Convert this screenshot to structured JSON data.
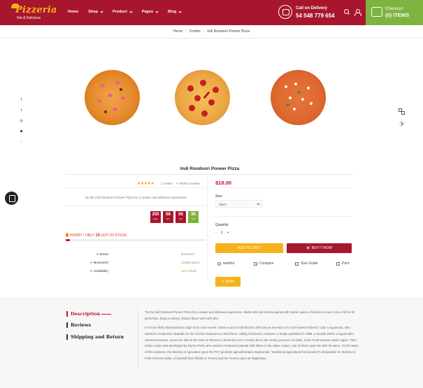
{
  "header": {
    "logo": {
      "title": "Pizzeria",
      "subtitle": "Hot & Delicious"
    },
    "nav": [
      {
        "label": "Home",
        "dropdown": false
      },
      {
        "label": "Shop",
        "dropdown": true
      },
      {
        "label": "Product",
        "dropdown": true
      },
      {
        "label": "Pages",
        "dropdown": true
      },
      {
        "label": "Blog",
        "dropdown": true
      }
    ],
    "delivery": {
      "label": "Call on Delivery",
      "phone": "54 548 779 654"
    },
    "checkout": {
      "label": "Checkout",
      "items": "(0) ITEMS"
    }
  },
  "breadcrumb": [
    "Home",
    "Combo",
    "Indi Rondoori Poneer Pizza"
  ],
  "social_icons": [
    "facebook-icon",
    "twitter-icon",
    "dribbble-icon",
    "instagram-icon",
    "whatsapp-icon"
  ],
  "product": {
    "title": "Indi Rondoori Poneer Pizza",
    "stars": "★★★★★",
    "review_count": "1 review",
    "write_review": "Write a review",
    "description": "Try the Indi Rondoori Poneer Pizza for a unique and delicious experience",
    "countdown": [
      {
        "value": "250",
        "unit": "Days"
      },
      {
        "value": "08",
        "unit": "Hrs"
      },
      {
        "value": "56",
        "unit": "Min"
      },
      {
        "value": "36",
        "unit": "Sec"
      }
    ],
    "stock": {
      "prefix": "HURRY ! ONLY",
      "count": "10",
      "suffix": "LEFT IN STOCK.",
      "level_percent": 3
    },
    "meta": [
      {
        "key": "Brand :",
        "value": "Domino's"
      },
      {
        "key": "Movement :",
        "value": "Combo pizza"
      },
      {
        "key": "Availability :",
        "value": "10 In Stock"
      }
    ],
    "price": "$18.00",
    "size_label": "Size",
    "size_selected": "25cm",
    "quantity_label": "Quantity",
    "quantity": {
      "minus": "-",
      "value": "1",
      "plus": "+"
    },
    "add_to_cart": "ADD TO CART",
    "buy_now": "BUY IT NOW",
    "actions": {
      "wishlist": "wishlist",
      "compare": "Compare",
      "size_guide": "Size Guide",
      "print": "Print"
    },
    "share": "Share"
  },
  "tabs": {
    "description": "Description",
    "reviews": "Reviews",
    "shipping": "Shipping and Return"
  },
  "description_text": {
    "p1": "Try the Indi Rondoori Poneer Pizza for a unique and delicious experience. Made with real cheese paired with classic spices, this pizza is sure to be a hit for all pizza fans. Enjoy a savory, cheesy flavor with each bite.",
    "p2": "It is more likely that tiramisu's origin is far more recent. Some sources hold that the dish was an invention of a chef named Roberto \"Loly\" Linguanotto, who wanted to modernize zbatudin for his Treviso restaurant Le Beccherie, calling it tiremesù. However, a recipe published in 1959, a decade before Linguanotto's claimed invention, traces the dish to the town of Tolmezzo, which lies not in Treviso but in the nearby province of Udine, in the Friuli-Venezia Giulia region. Their earlier recipe was developed by Norma Pielli, who owned a restaurant popular with hikers in the Alpine region, one of whom gave the dish its name. On the basis of this evidence, the Ministry of Agriculture gave the PAT (prodotto agroalimentare tradizionale, \"traditional agricultural food product\") designation for tiramisu to Friuli-Venezia Giulia, a foodstuff that officials in Treviso and the Veneto reject as illegitimate."
  }
}
